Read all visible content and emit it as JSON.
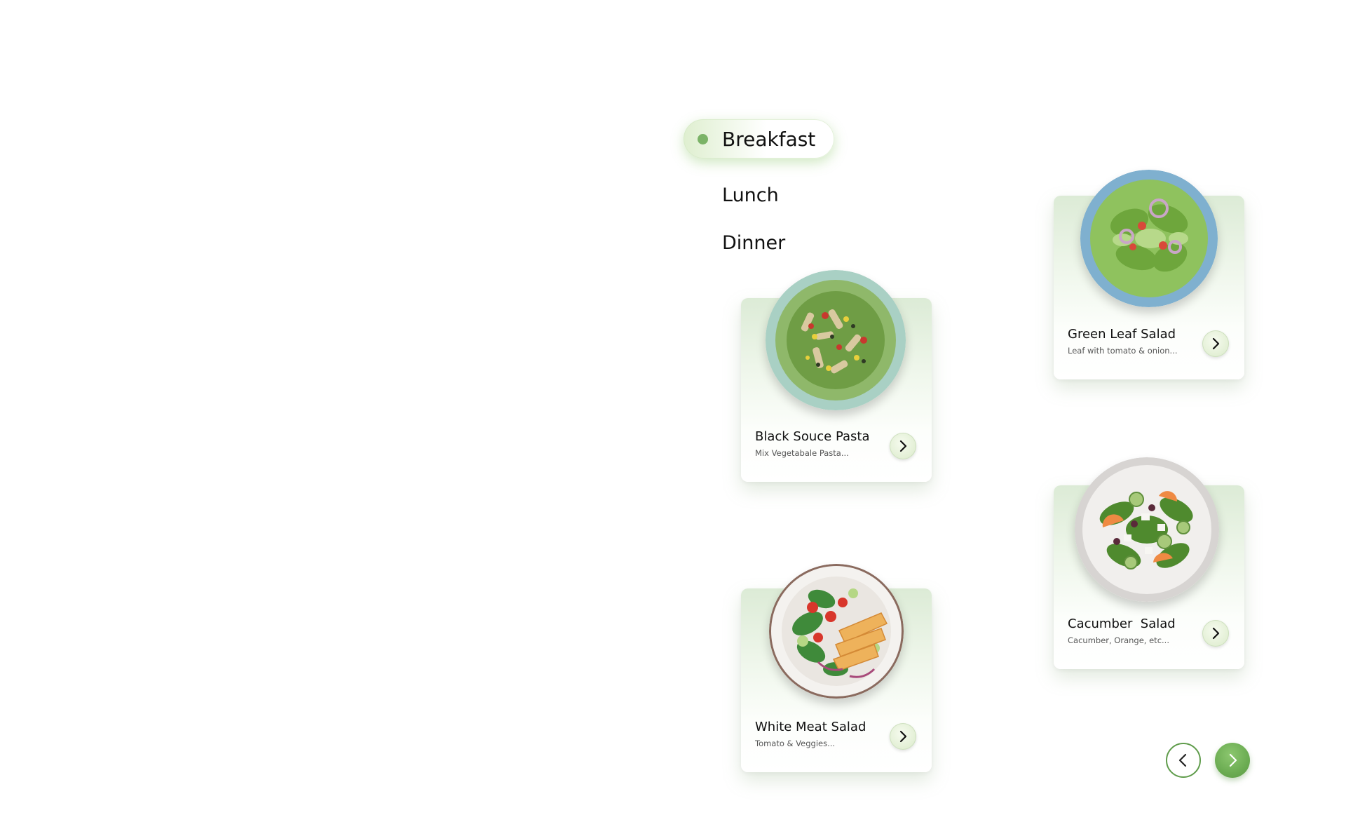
{
  "tabs": {
    "active_label": "Breakfast",
    "lunch_label": "Lunch",
    "dinner_label": "Dinner"
  },
  "cards": [
    {
      "name": "Black Souce Pasta",
      "description": "Mix Vegetabale Pasta..."
    },
    {
      "name": "Green Leaf Salad",
      "description": "Leaf with tomato & onion..."
    },
    {
      "name": "White Meat Salad",
      "description": "Tomato & Veggies..."
    },
    {
      "name": "Cacumber  Salad",
      "description": "Cacumber, Orange, etc..."
    }
  ],
  "colors": {
    "accent_green": "#6bac52",
    "active_dot": "#7bb367"
  },
  "icons": {
    "card_action": "chevron-right-icon",
    "pager_prev": "chevron-left-icon",
    "pager_next": "chevron-right-icon"
  }
}
